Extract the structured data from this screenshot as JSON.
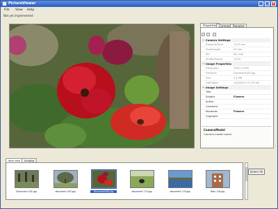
{
  "window": {
    "title": "PictureViewer",
    "colors": {
      "titlebar": "#2a5cc4",
      "window_bg": "#ece9d8"
    }
  },
  "menu": [
    "File",
    "View",
    "Help"
  ],
  "status": "Not yet implemented",
  "main_image": {
    "description_icon": "flower-photo"
  },
  "properties": {
    "tabs": [
      "Properties",
      "Comment",
      "Rename"
    ],
    "active_tab": 0,
    "categories": [
      {
        "name": "Camera Settings",
        "rows": [
          {
            "k": "ExposureTime",
            "v": "1/125 sec."
          },
          {
            "k": "FocalLength",
            "v": "50 mm"
          },
          {
            "k": "ISO",
            "v": "ISO-100"
          },
          {
            "k": "ShutterSpeed",
            "v": "1/125"
          }
        ]
      },
      {
        "name": "Image Properties",
        "rows": [
          {
            "k": "Dimension",
            "v": "3000 x 2000"
          },
          {
            "k": "Filename",
            "v": "Document182.jpg"
          },
          {
            "k": "Size",
            "v": "2.4 MB"
          },
          {
            "k": "DateTaken",
            "v": "1/4/2006 2:17:53 AM"
          }
        ]
      },
      {
        "name": "Image Settings",
        "rows": [
          {
            "k": "Title",
            "v": ""
          },
          {
            "k": "Subject",
            "v": "Flowers",
            "active": true
          },
          {
            "k": "Author",
            "v": ""
          },
          {
            "k": "Comment",
            "v": ""
          },
          {
            "k": "Keywords",
            "v": "Flowers",
            "active": true
          },
          {
            "k": "Copyright",
            "v": ""
          }
        ]
      }
    ],
    "description": {
      "title": "CameraModel",
      "text": "Camera model name"
    }
  },
  "bottom": {
    "tabs": [
      "Item view",
      "Imaging"
    ],
    "active_tab": 0,
    "thumbnails": [
      {
        "label": "Document 182.jpg",
        "scene": "forest"
      },
      {
        "label": "document 183.jpg",
        "scene": "tree"
      },
      {
        "label": "Document184.jpg",
        "scene": "flower",
        "selected": true
      },
      {
        "label": "document 175.jpg",
        "scene": "dog"
      },
      {
        "label": "document 176.jpg",
        "scene": "lake"
      },
      {
        "label": "Rotu 116.jpg",
        "scene": "building"
      }
    ],
    "select_all": "Select All"
  }
}
